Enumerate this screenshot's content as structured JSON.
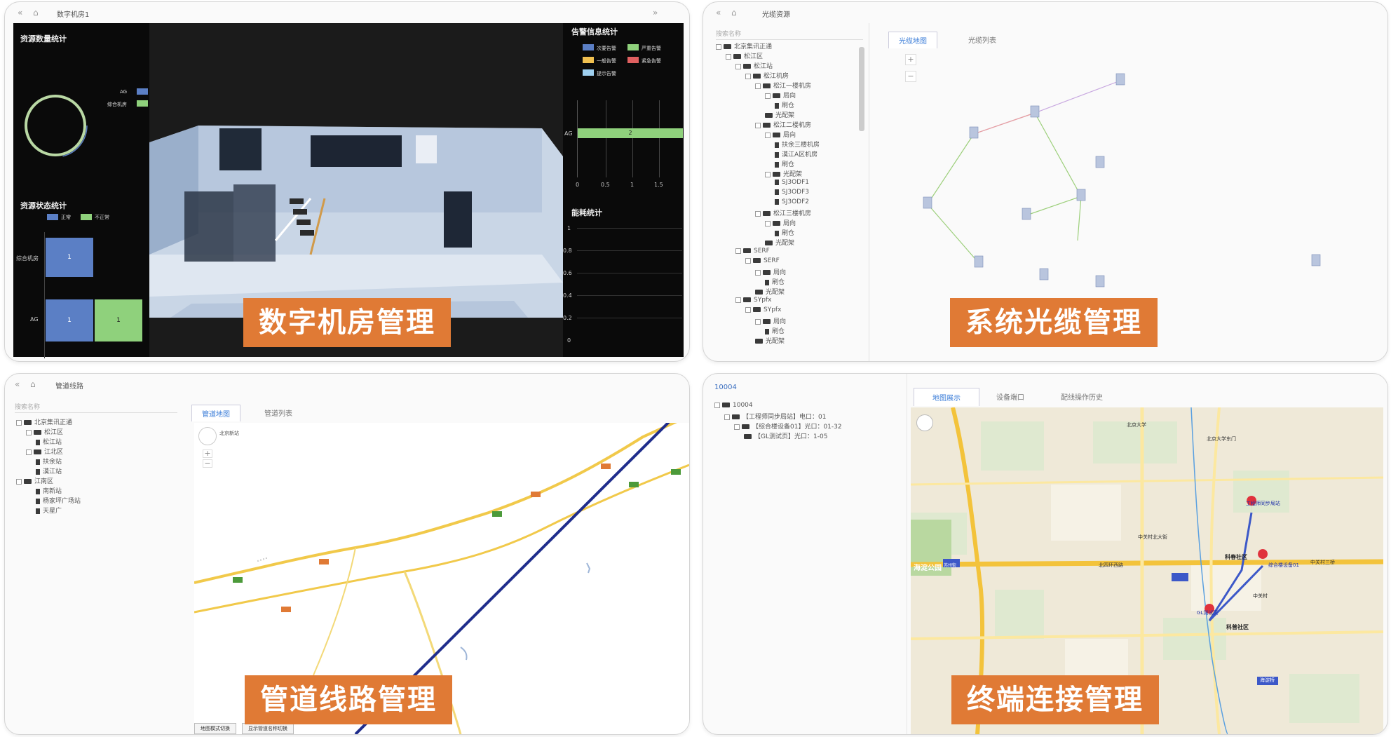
{
  "captions": {
    "tl": "数字机房管理",
    "tr": "系统光缆管理",
    "bl": "管道线路管理",
    "br": "终端连接管理"
  },
  "tl": {
    "tab_title": "数字机房1",
    "resource_count_title": "资源数量统计",
    "legend_ag": "AG",
    "legend_room": "综合机房",
    "resource_status_title": "资源状态统计",
    "status_legend_normal": "正常",
    "status_legend_abnormal": "不正常",
    "status_rows": [
      "综合机房",
      "AG"
    ],
    "status_values": [
      "1",
      "1",
      "1"
    ],
    "alarm_title": "告警信息统计",
    "alarm_legend": [
      "次要告警",
      "严重告警",
      "一般告警",
      "紧急告警",
      "提示告警"
    ],
    "alarm_row": "AG",
    "alarm_value": "2",
    "alarm_ticks": [
      "0",
      "0.5",
      "1",
      "1.5"
    ],
    "energy_title": "能耗统计",
    "energy_ticks": [
      "1",
      "0.8",
      "0.6",
      "0.4",
      "0.2",
      "0"
    ]
  },
  "tr": {
    "tab_title": "光缆资源",
    "search_placeholder": "搜索名称",
    "tabs": [
      "光缆地图",
      "光缆列表"
    ],
    "tree": [
      "北京集讯正通",
      "松江区",
      "松江站",
      "松江机房",
      "松江一楼机房",
      "局向",
      "刷仓",
      "光配架",
      "松江二楼机房",
      "局向",
      "扶余三楼机房",
      "漠江A区机房",
      "刷仓",
      "光配架",
      "SJ3ODF1",
      "SJ3ODF3",
      "SJ3ODF2",
      "松江三楼机房",
      "局向",
      "刷仓",
      "光配架",
      "SERF",
      "SERF",
      "局向",
      "刷仓",
      "光配架",
      "SYpfx",
      "SYpfx",
      "局向",
      "刷仓",
      "光配架"
    ],
    "zoom_in": "+",
    "zoom_out": "−"
  },
  "bl": {
    "tab_title": "管道线路",
    "search_placeholder": "搜索名称",
    "tabs": [
      "管道地图",
      "管道列表"
    ],
    "tree": [
      "北京集讯正通",
      "松江区",
      "松江站",
      "江北区",
      "扶余站",
      "漠江站",
      "江南区",
      "南新站",
      "杨家坪广场站",
      "天星广"
    ],
    "map_label": "北京新站",
    "bottom_buttons": [
      "地图模式切换",
      "显示管道名称切换"
    ]
  },
  "br": {
    "header": "10004",
    "tabs": [
      "地图展示",
      "设备端口",
      "配线操作历史"
    ],
    "tree": [
      "10004",
      "【工程师同步局站】电口：01",
      "【综合楼设备01】光口：01-32",
      "【GL测试页】光口：1-05"
    ],
    "map_labels": [
      "北京大学",
      "北京大学东门",
      "海淀公园",
      "苏州街",
      "中关村",
      "科春社区",
      "科普社区",
      "海淀桥",
      "北四环西路",
      "中关村三桥",
      "中关村北大街",
      "工程师同步局站",
      "GL测试页",
      "综合楼设备01"
    ]
  }
}
